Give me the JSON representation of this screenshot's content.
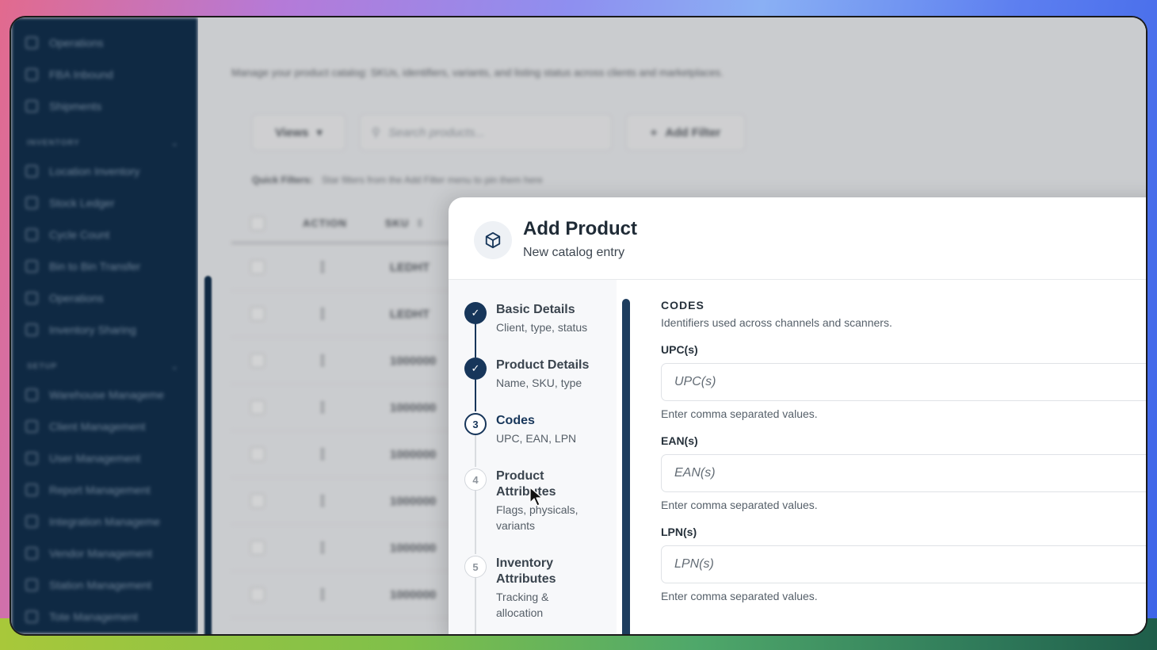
{
  "sidebar": {
    "items_top": [
      {
        "label": "Operations",
        "icon": "operations-icon"
      },
      {
        "label": "FBA Inbound",
        "icon": "inbound-icon"
      },
      {
        "label": "Shipments",
        "icon": "truck-icon"
      }
    ],
    "inventory_section": "INVENTORY",
    "inventory_items": [
      {
        "label": "Location Inventory",
        "icon": "location-icon"
      },
      {
        "label": "Stock Ledger",
        "icon": "ledger-icon"
      },
      {
        "label": "Cycle Count",
        "icon": "cycle-icon"
      },
      {
        "label": "Bin to Bin Transfer",
        "icon": "transfer-icon"
      },
      {
        "label": "Operations",
        "icon": "operations-icon"
      },
      {
        "label": "Inventory Sharing",
        "icon": "share-icon"
      }
    ],
    "setup_section": "SETUP",
    "setup_items": [
      {
        "label": "Warehouse Manageme",
        "icon": "warehouse-icon"
      },
      {
        "label": "Client Management",
        "icon": "client-icon"
      },
      {
        "label": "User Management",
        "icon": "user-icon"
      },
      {
        "label": "Report Management",
        "icon": "report-icon"
      },
      {
        "label": "Integration Manageme",
        "icon": "integration-icon"
      },
      {
        "label": "Vendor Management",
        "icon": "vendor-icon"
      },
      {
        "label": "Station Management",
        "icon": "station-icon"
      },
      {
        "label": "Tote Management",
        "icon": "tote-icon"
      }
    ]
  },
  "background": {
    "subtitle": "Manage your product catalog: SKUs, identifiers, variants, and listing status across clients and marketplaces.",
    "views_label": "Views",
    "search_placeholder": "Search products...",
    "add_filter_label": "Add Filter",
    "quick_filters_label": "Quick Filters:",
    "quick_filters_hint": "Star filters from the Add Filter menu to pin them here",
    "columns": {
      "action": "ACTION",
      "sku": "SKU"
    },
    "rows": [
      "LEDHT",
      "LEDHT",
      "1000000",
      "1000000",
      "1000000",
      "1000000",
      "1000000",
      "1000000"
    ]
  },
  "modal": {
    "title": "Add Product",
    "subtitle": "New catalog entry",
    "steps": [
      {
        "num": "1",
        "title": "Basic Details",
        "desc": "Client, type, status",
        "state": "done"
      },
      {
        "num": "2",
        "title": "Product Details",
        "desc": "Name, SKU, type",
        "state": "done"
      },
      {
        "num": "3",
        "title": "Codes",
        "desc": "UPC, EAN, LPN",
        "state": "active"
      },
      {
        "num": "4",
        "title": "Product Attributes",
        "desc": "Flags, physicals, variants",
        "state": "todo"
      },
      {
        "num": "5",
        "title": "Inventory Attributes",
        "desc": "Tracking & allocation",
        "state": "todo"
      }
    ],
    "form": {
      "section_title": "CODES",
      "section_desc": "Identifiers used across channels and scanners.",
      "fields": [
        {
          "label": "UPC(s)",
          "placeholder": "UPC(s)",
          "hint": "Enter comma separated values."
        },
        {
          "label": "EAN(s)",
          "placeholder": "EAN(s)",
          "hint": "Enter comma separated values."
        },
        {
          "label": "LPN(s)",
          "placeholder": "LPN(s)",
          "hint": "Enter comma separated values."
        }
      ]
    }
  },
  "colors": {
    "accent": "#17365a",
    "sidebar": "#0f2943"
  }
}
